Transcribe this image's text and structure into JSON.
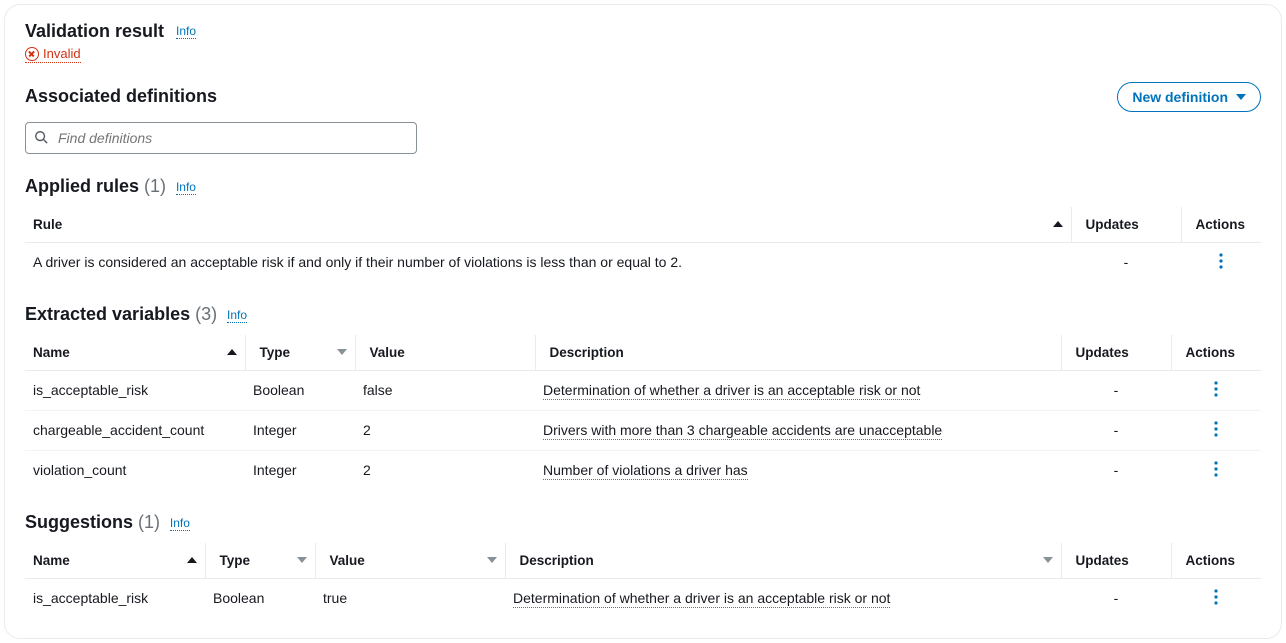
{
  "header": {
    "title": "Validation result",
    "info_label": "Info",
    "status_label": "Invalid"
  },
  "associated": {
    "title": "Associated definitions",
    "new_button": "New definition",
    "search_placeholder": "Find definitions"
  },
  "applied_rules": {
    "title": "Applied rules",
    "count": "(1)",
    "info_label": "Info",
    "columns": {
      "rule": "Rule",
      "updates": "Updates",
      "actions": "Actions"
    },
    "rows": [
      {
        "rule": "A driver is considered an acceptable risk if and only if their number of violations is less than or equal to 2.",
        "updates": "-"
      }
    ]
  },
  "extracted": {
    "title": "Extracted variables",
    "count": "(3)",
    "info_label": "Info",
    "columns": {
      "name": "Name",
      "type": "Type",
      "value": "Value",
      "description": "Description",
      "updates": "Updates",
      "actions": "Actions"
    },
    "rows": [
      {
        "name": "is_acceptable_risk",
        "type": "Boolean",
        "value": "false",
        "description": "Determination of whether a driver is an acceptable risk or not",
        "updates": "-"
      },
      {
        "name": "chargeable_accident_count",
        "type": "Integer",
        "value": "2",
        "description": "Drivers with more than 3 chargeable accidents are unacceptable",
        "updates": "-"
      },
      {
        "name": "violation_count",
        "type": "Integer",
        "value": "2",
        "description": "Number of violations a driver has",
        "updates": "-"
      }
    ]
  },
  "suggestions": {
    "title": "Suggestions",
    "count": "(1)",
    "info_label": "Info",
    "columns": {
      "name": "Name",
      "type": "Type",
      "value": "Value",
      "description": "Description",
      "updates": "Updates",
      "actions": "Actions"
    },
    "rows": [
      {
        "name": "is_acceptable_risk",
        "type": "Boolean",
        "value": "true",
        "description": "Determination of whether a driver is an acceptable risk or not",
        "updates": "-"
      }
    ]
  }
}
